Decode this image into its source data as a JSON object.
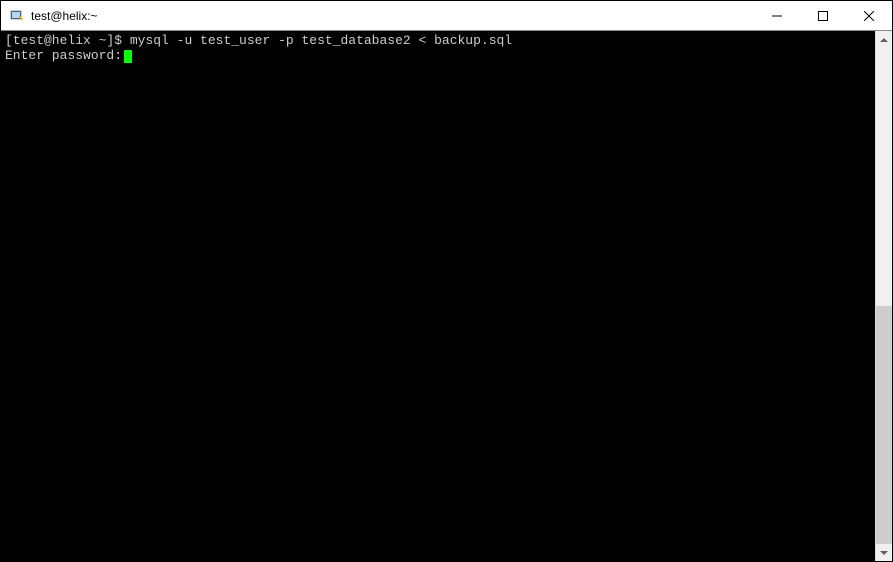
{
  "window": {
    "title": "test@helix:~"
  },
  "terminal": {
    "prompt": "[test@helix ~]$",
    "command": "mysql -u test_user -p test_database2 < backup.sql",
    "password_prompt": "Enter password:"
  }
}
